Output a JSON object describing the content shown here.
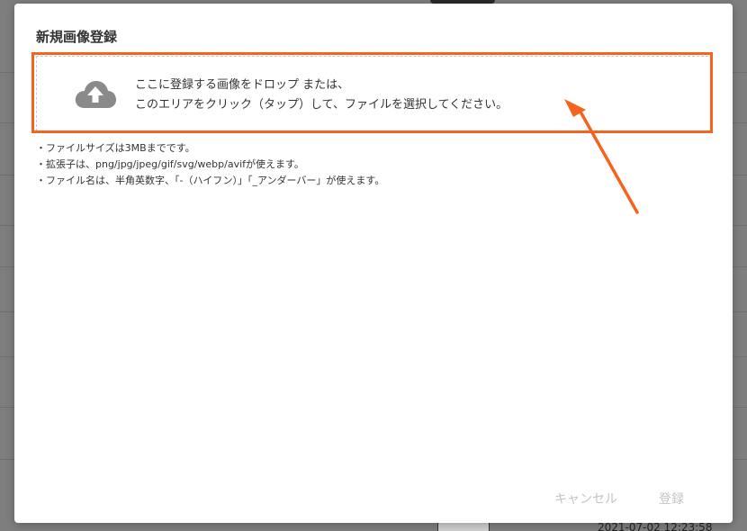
{
  "modal": {
    "title": "新規画像登録"
  },
  "dropzone": {
    "line1": "ここに登録する画像をドロップ または、",
    "line2": "このエリアをクリック（タップ）して、ファイルを選択してください。",
    "icon": "cloud-upload-icon"
  },
  "notes": [
    "・ファイルサイズは3MBまでです。",
    "・拡張子は、png/jpg/jpeg/gif/svg/webp/avifが使えます。",
    "・ファイル名は、半角英数字、「-（ハイフン）」「_アンダーバー」が使えます。"
  ],
  "footer": {
    "cancel_label": "キャンセル",
    "submit_label": "登録"
  },
  "background": {
    "timestamp": "2021-07-02 12:23:58"
  },
  "colors": {
    "highlight": "#f5631e",
    "icon": "#8a8a8a",
    "disabled_button": "#c4c4c4"
  }
}
